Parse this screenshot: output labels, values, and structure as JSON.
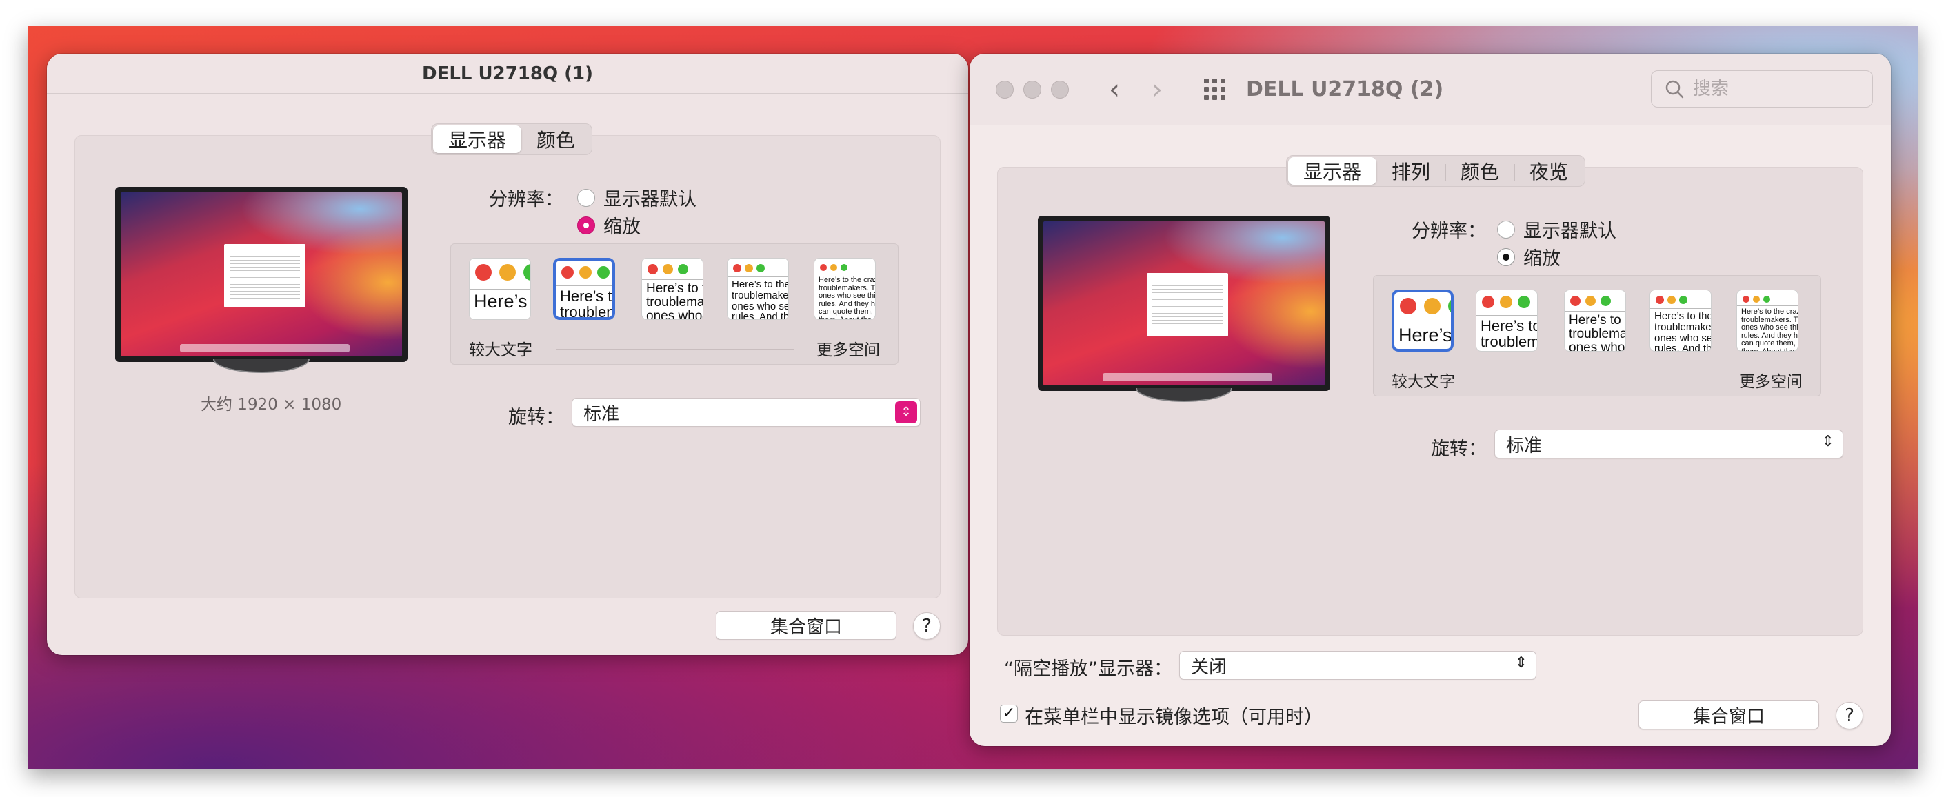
{
  "left_window": {
    "title": "DELL U2718Q (1)",
    "tabs": [
      {
        "label": "显示器",
        "active": true
      },
      {
        "label": "颜色",
        "active": false
      }
    ],
    "resolution_note": "大约 1920 × 1080",
    "resolution_label": "分辨率：",
    "resolution_options": [
      {
        "label": "显示器默认",
        "selected": false
      },
      {
        "label": "缩放",
        "selected": true
      }
    ],
    "scale_min_label": "较大文字",
    "scale_max_label": "更多空间",
    "scale_selected_index": 1,
    "rotation_label": "旋转：",
    "rotation_value": "标准",
    "gather_button": "集合窗口",
    "help_button": "?"
  },
  "right_window": {
    "title": "DELL U2718Q (2)",
    "search_placeholder": "搜索",
    "tabs": [
      {
        "label": "显示器",
        "active": true
      },
      {
        "label": "排列",
        "active": false
      },
      {
        "label": "颜色",
        "active": false
      },
      {
        "label": "夜览",
        "active": false
      }
    ],
    "resolution_label": "分辨率：",
    "resolution_options": [
      {
        "label": "显示器默认",
        "selected": false
      },
      {
        "label": "缩放",
        "selected": true
      }
    ],
    "scale_min_label": "较大文字",
    "scale_max_label": "更多空间",
    "scale_selected_index": 0,
    "rotation_label": "旋转：",
    "rotation_value": "标准",
    "airplay_label": "“隔空播放”显示器：",
    "airplay_value": "关闭",
    "mirror_checkbox_label": "在菜单栏中显示镜像选项（可用时）",
    "mirror_checked": true,
    "gather_button": "集合窗口",
    "help_button": "?"
  },
  "scale_thumbs": [
    {
      "text": "Here’s"
    },
    {
      "text": "Here’s to\ntroublem"
    },
    {
      "text": "Here’s to t\ntroublema\nones who"
    },
    {
      "text": "Here’s to the c\ntroublemakers.\nones who see t\nrules. And they"
    },
    {
      "text": "Here’s to the crazy one\ntroublemakers. The rou\nones who see things dif\nrules. And they have no\ncan quote them, disagr\nthem. About the only th\nBecause they change th"
    }
  ],
  "colors": {
    "accent_pink": "#e0177f",
    "selection_blue": "#3d6fd6",
    "dot_red": "#e8413a",
    "dot_yellow": "#f0a92a",
    "dot_green": "#3fbf3a"
  }
}
